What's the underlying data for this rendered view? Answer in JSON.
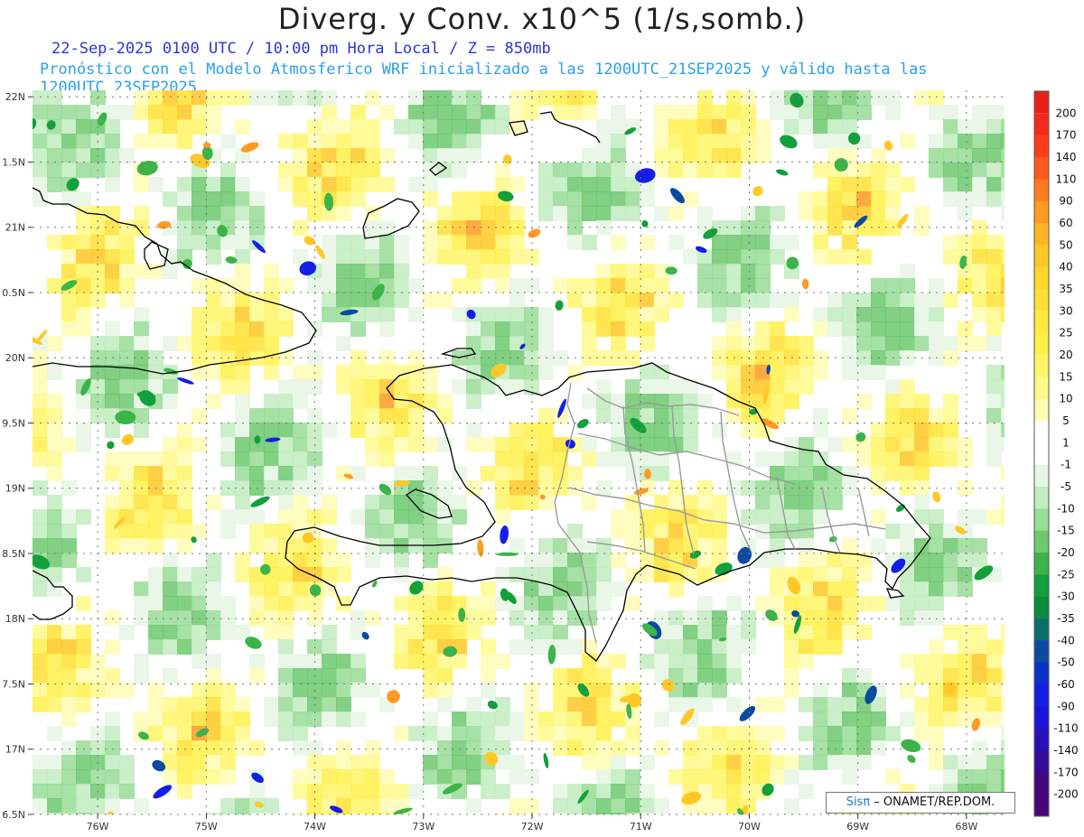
{
  "title": "Diverg. y Conv. x10^5 (1/s,somb.)",
  "subtitle_time": "22-Sep-2025 0100 UTC / 10:00 pm Hora Local / Z = 850mb",
  "subtitle_model": "Pronóstico con el Modelo Atmosferico WRF inicializado a las 1200UTC_21SEP2025 y válido hasta las  1200UTC_23SEP2025",
  "credit": {
    "brand": "Sisπ",
    "text": " – ONAMET/REP.DOM."
  },
  "map": {
    "lon_range": [
      -76.6,
      -67.65
    ],
    "lat_range": [
      16.5,
      22.05
    ],
    "lat_ticks": [
      {
        "v": 22.0,
        "label": "22N"
      },
      {
        "v": 21.5,
        "label": "1.5N"
      },
      {
        "v": 21.0,
        "label": "21N"
      },
      {
        "v": 20.5,
        "label": "0.5N"
      },
      {
        "v": 20.0,
        "label": "20N"
      },
      {
        "v": 19.5,
        "label": "9.5N"
      },
      {
        "v": 19.0,
        "label": "19N"
      },
      {
        "v": 18.5,
        "label": "8.5N"
      },
      {
        "v": 18.0,
        "label": "18N"
      },
      {
        "v": 17.5,
        "label": "7.5N"
      },
      {
        "v": 17.0,
        "label": "17N"
      },
      {
        "v": 16.5,
        "label": "6.5N"
      }
    ],
    "lon_ticks": [
      {
        "v": -76,
        "label": "76W"
      },
      {
        "v": -75,
        "label": "75W"
      },
      {
        "v": -74,
        "label": "74W"
      },
      {
        "v": -73,
        "label": "73W"
      },
      {
        "v": -72,
        "label": "72W"
      },
      {
        "v": -71,
        "label": "71W"
      },
      {
        "v": -70,
        "label": "70W"
      },
      {
        "v": -69,
        "label": "69W"
      },
      {
        "v": -68,
        "label": "68W"
      }
    ]
  },
  "colorbar": [
    {
      "label": "200",
      "color": "#e8201a"
    },
    {
      "label": "170",
      "color": "#f22a1c"
    },
    {
      "label": "140",
      "color": "#ff3c1c"
    },
    {
      "label": "110",
      "color": "#ff5a1e"
    },
    {
      "label": "90",
      "color": "#ff7a20"
    },
    {
      "label": "60",
      "color": "#ff9a22"
    },
    {
      "label": "50",
      "color": "#ffb424"
    },
    {
      "label": "40",
      "color": "#ffc826"
    },
    {
      "label": "35",
      "color": "#ffd62a"
    },
    {
      "label": "30",
      "color": "#ffe032"
    },
    {
      "label": "25",
      "color": "#ffea3c"
    },
    {
      "label": "20",
      "color": "#fff04a"
    },
    {
      "label": "15",
      "color": "#fff566"
    },
    {
      "label": "10",
      "color": "#fff98a"
    },
    {
      "label": "5",
      "color": "#fffcb4"
    },
    {
      "label": "1",
      "color": "#ffffff"
    },
    {
      "label": "-1",
      "color": "#ffffff"
    },
    {
      "label": "-5",
      "color": "#e6f6e4"
    },
    {
      "label": "-10",
      "color": "#c2ecc0"
    },
    {
      "label": "-15",
      "color": "#98dc96"
    },
    {
      "label": "-20",
      "color": "#6cc86e"
    },
    {
      "label": "-25",
      "color": "#3cb44a"
    },
    {
      "label": "-30",
      "color": "#12a03a"
    },
    {
      "label": "-35",
      "color": "#0a8c3c"
    },
    {
      "label": "-40",
      "color": "#0a6e6a"
    },
    {
      "label": "-50",
      "color": "#0a4aa0"
    },
    {
      "label": "-60",
      "color": "#0a32c8"
    },
    {
      "label": "-90",
      "color": "#141ee6"
    },
    {
      "label": "-110",
      "color": "#1c14d8"
    },
    {
      "label": "-140",
      "color": "#2810b8"
    },
    {
      "label": "-170",
      "color": "#340c9a"
    },
    {
      "label": "-200",
      "color": "#42087e"
    }
  ],
  "colorbar_bottom_color": "#4a0678"
}
